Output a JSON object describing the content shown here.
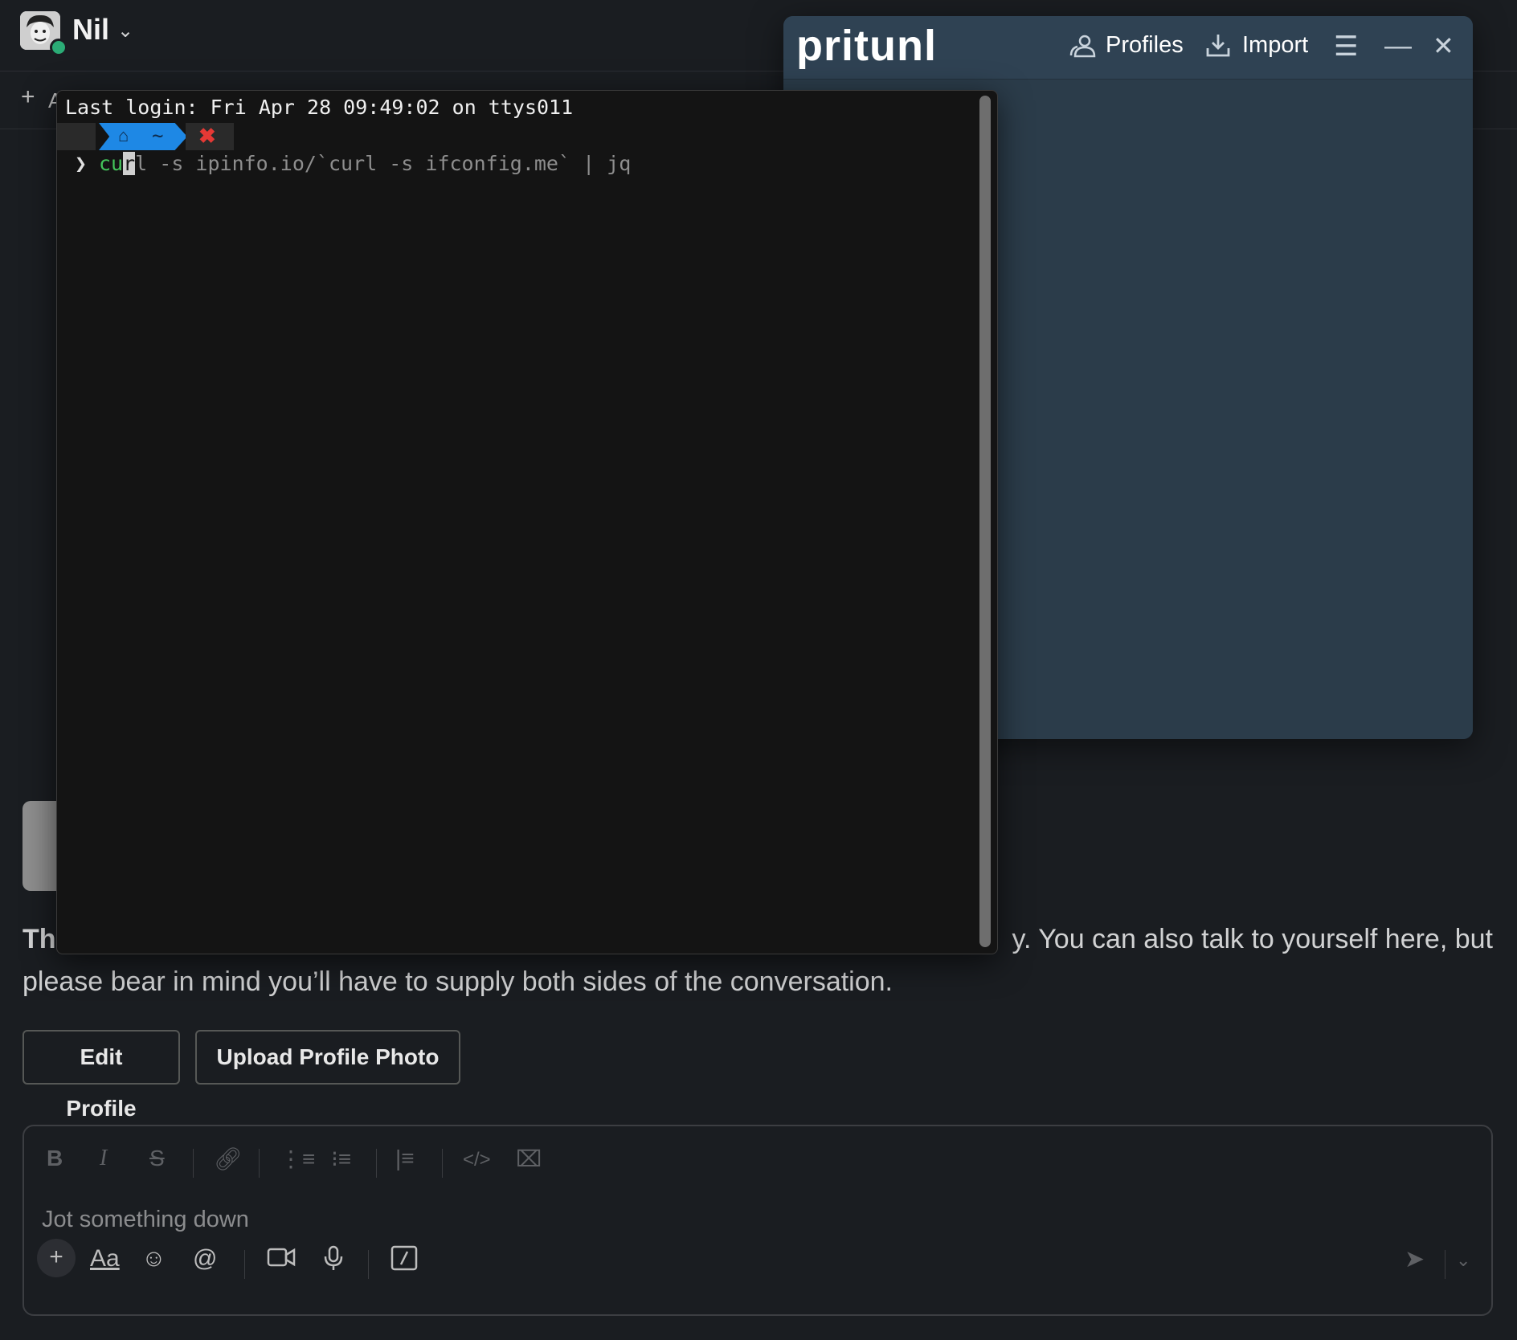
{
  "slack": {
    "user_name": "Nil",
    "bookmark_label": "A",
    "intro_visible_start": "Th",
    "intro_line1_tail": "y. You can also talk to yourself here, but",
    "intro_line2": "please bear in mind you’ll have to supply both sides of the conversation.",
    "edit_profile": "Edit Profile",
    "upload_photo": "Upload Profile Photo",
    "composer_placeholder": "Jot something down",
    "format_label": "Aa"
  },
  "terminal": {
    "last_login": "Last login: Fri Apr 28 09:49:02 on ttys011",
    "home_label": "~",
    "prompt_symbol": "❯",
    "cmd_typed_green": "cu",
    "cmd_cursor_char": "r",
    "cmd_rest": "l -s ipinfo.io/`curl -s ifconfig.me` | jq"
  },
  "pritunl": {
    "logo": "pritunl",
    "profiles_label": "Profiles",
    "import_label": "Import"
  },
  "colors": {
    "slack_bg": "#1a1d21",
    "terminal_bg": "#141414",
    "pritunl_bg": "#2b3c4a",
    "prompt_blue": "#1e88e5",
    "cmd_green": "#43c35a",
    "presence_green": "#2bac76"
  }
}
